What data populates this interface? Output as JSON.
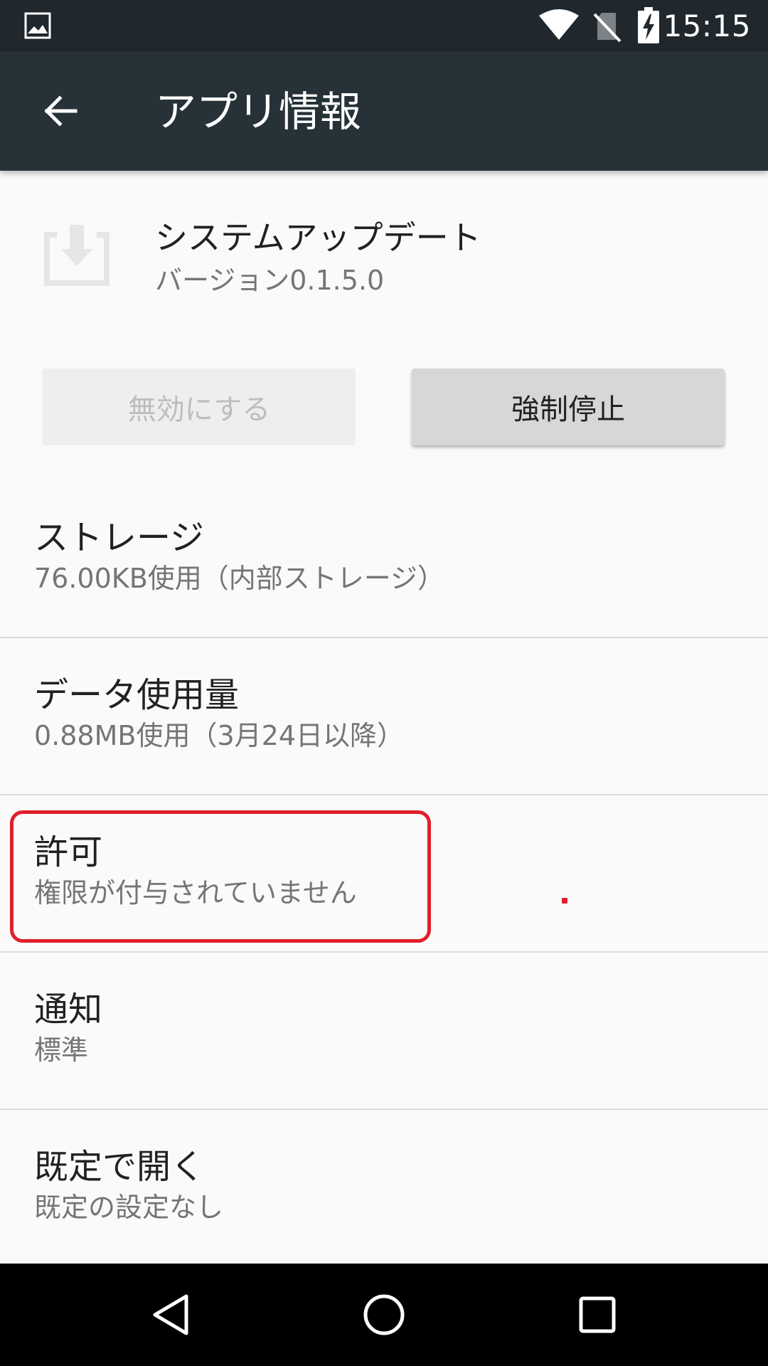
{
  "status_bar": {
    "time": "15:15",
    "icons": [
      "gallery-icon",
      "wifi-icon",
      "no-sim-icon",
      "battery-charging-icon"
    ]
  },
  "app_bar": {
    "title": "アプリ情報",
    "back_icon": "arrow-back-icon",
    "background": "#263238"
  },
  "app": {
    "name": "システムアップデート",
    "version": "バージョン0.1.5.0",
    "icon": "system-update-icon"
  },
  "buttons": {
    "disable_label": "無効にする",
    "force_stop_label": "強制停止"
  },
  "items": [
    {
      "title": "ストレージ",
      "subtitle": "76.00KB使用（内部ストレージ）"
    },
    {
      "title": "データ使用量",
      "subtitle": "0.88MB使用（3月24日以降）"
    },
    {
      "title": "許可",
      "subtitle": "権限が付与されていません"
    },
    {
      "title": "通知",
      "subtitle": "標準"
    },
    {
      "title": "既定で開く",
      "subtitle": "既定の設定なし"
    }
  ],
  "highlight_color": "#e0202a",
  "nav_bar": {
    "icons": [
      "nav-back-icon",
      "nav-home-icon",
      "nav-recents-icon"
    ]
  }
}
